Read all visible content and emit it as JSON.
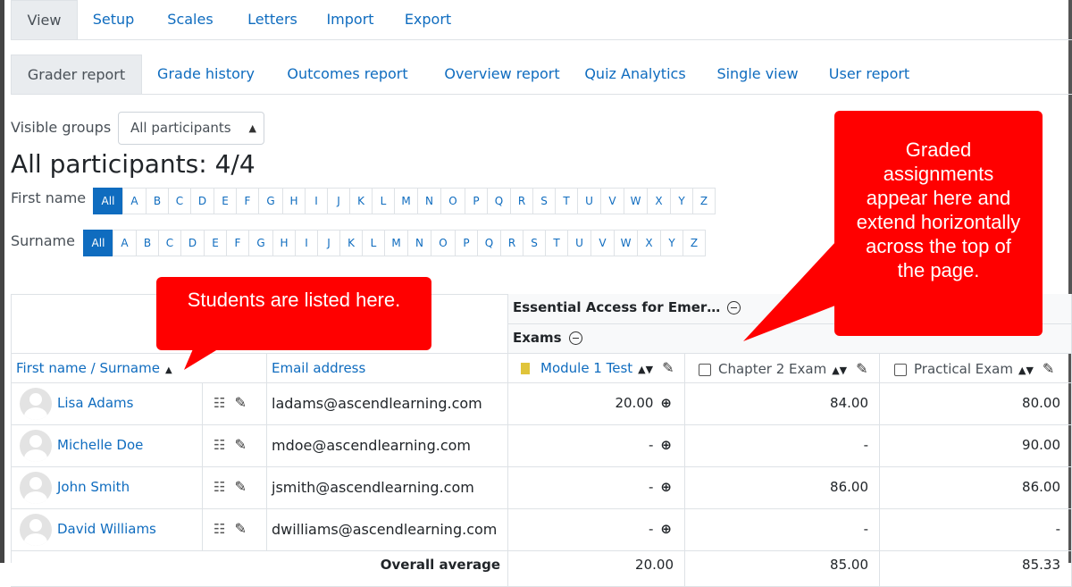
{
  "primary_tabs": [
    {
      "label": "View",
      "active": true
    },
    {
      "label": "Setup",
      "active": false
    },
    {
      "label": "Scales",
      "active": false
    },
    {
      "label": "Letters",
      "active": false
    },
    {
      "label": "Import",
      "active": false
    },
    {
      "label": "Export",
      "active": false
    }
  ],
  "secondary_tabs": [
    {
      "label": "Grader report",
      "active": true
    },
    {
      "label": "Grade history",
      "active": false
    },
    {
      "label": "Outcomes report",
      "active": false
    },
    {
      "label": "Overview report",
      "active": false
    },
    {
      "label": "Quiz Analytics",
      "active": false
    },
    {
      "label": "Single view",
      "active": false
    },
    {
      "label": "User report",
      "active": false
    }
  ],
  "groups": {
    "label": "Visible groups",
    "selected": "All participants"
  },
  "heading": "All participants: 4/4",
  "firstname_filter": {
    "label": "First name",
    "all": "All"
  },
  "surname_filter": {
    "label": "Surname",
    "all": "All"
  },
  "letters": [
    "A",
    "B",
    "C",
    "D",
    "E",
    "F",
    "G",
    "H",
    "I",
    "J",
    "K",
    "L",
    "M",
    "N",
    "O",
    "P",
    "Q",
    "R",
    "S",
    "T",
    "U",
    "V",
    "W",
    "X",
    "Y",
    "Z"
  ],
  "table": {
    "category": "Essential Access for Emer…",
    "subcategory": "Exams",
    "col_name": "First name / Surname",
    "col_email": "Email address",
    "items": [
      "Module 1 Test",
      "Chapter 2 Exam",
      "Practical Exam"
    ],
    "rows": [
      {
        "name": "Lisa Adams",
        "email": "ladams@ascendlearning.com",
        "grades": [
          "20.00",
          "84.00",
          "80.00"
        ]
      },
      {
        "name": "Michelle Doe",
        "email": "mdoe@ascendlearning.com",
        "grades": [
          "-",
          "-",
          "90.00"
        ]
      },
      {
        "name": "John Smith",
        "email": "jsmith@ascendlearning.com",
        "grades": [
          "-",
          "86.00",
          "86.00"
        ]
      },
      {
        "name": "David Williams",
        "email": "dwilliams@ascendlearning.com",
        "grades": [
          "-",
          "-",
          "-"
        ]
      }
    ],
    "overall": {
      "label": "Overall average",
      "values": [
        "20.00",
        "85.00",
        "85.33"
      ]
    }
  },
  "callouts": {
    "students": "Students are listed here.",
    "graded": "Graded assignments appear here and extend horizontally across the top of the page."
  },
  "colors": {
    "link": "#0f6cbf",
    "callout": "#ff0000",
    "active_tab_bg": "#e9ecef"
  }
}
